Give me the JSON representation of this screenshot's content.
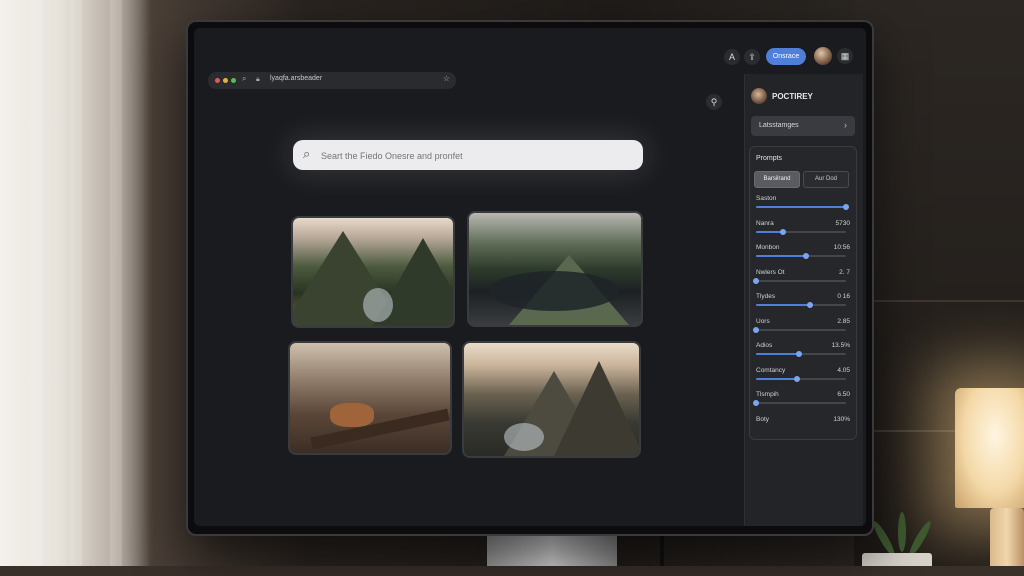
{
  "browser": {
    "url": "lyaqfa.arsbeader",
    "search_placeholder": "Seart the Fiedo Onesre and pronfet"
  },
  "header": {
    "primary_button": "Onsrace"
  },
  "panel": {
    "title": "POCTIREY",
    "dropdown_label": "Latsstamges",
    "prompts_title": "Prompts",
    "segments": [
      "Barsilrand",
      "Aur Dod"
    ],
    "sliders": [
      {
        "label": "Saston",
        "value": "",
        "level": 1.0
      },
      {
        "label": "Nanra",
        "value": "5730",
        "level": 0.3
      },
      {
        "label": "Monbon",
        "value": "10:56",
        "level": 0.55
      },
      {
        "label": "Nwlers Ot",
        "value": "2. 7",
        "level": 0.0
      },
      {
        "label": "Tlydes",
        "value": "0 16",
        "level": 0.6
      },
      {
        "label": "Uors",
        "value": "2.85",
        "level": 0.0
      },
      {
        "label": "Adios",
        "value": "13.5%",
        "level": 0.48
      },
      {
        "label": "Comtancy",
        "value": "4.05",
        "level": 0.45
      },
      {
        "label": "Tlsmpih",
        "value": "6.50",
        "level": 0.0
      },
      {
        "label": "Boty",
        "value": "130%",
        "level": null
      }
    ]
  },
  "icons": {
    "notification": "bell-user-icon",
    "share": "share-icon",
    "menu": "grid-icon",
    "mic": "microphone-icon"
  }
}
